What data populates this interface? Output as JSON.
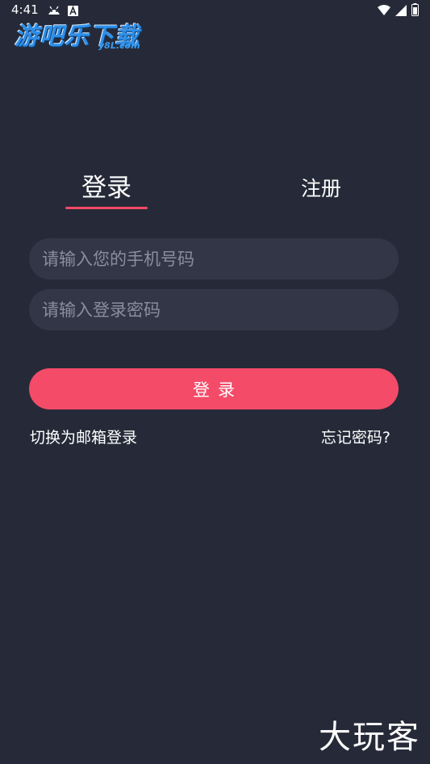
{
  "status_bar": {
    "time": "4:41",
    "left_icons": [
      "android-debug-icon",
      "a-notification-icon"
    ],
    "right_icons": [
      "wifi-icon",
      "signal-icon",
      "battery-icon"
    ]
  },
  "watermark": {
    "logo_text": "游吧乐下载",
    "logo_sub": "y8L.com",
    "bottom_text": "大玩客"
  },
  "tabs": {
    "login": "登录",
    "register": "注册"
  },
  "form": {
    "phone_placeholder": "请输入您的手机号码",
    "phone_value": "",
    "password_placeholder": "请输入登录密码",
    "password_value": "",
    "login_button": "登录"
  },
  "links": {
    "switch_email": "切换为邮箱登录",
    "forgot_password": "忘记密码?"
  },
  "colors": {
    "background": "#262a38",
    "input_bg": "#323646",
    "accent": "#f34b68",
    "logo_blue": "#2f8fe8"
  }
}
